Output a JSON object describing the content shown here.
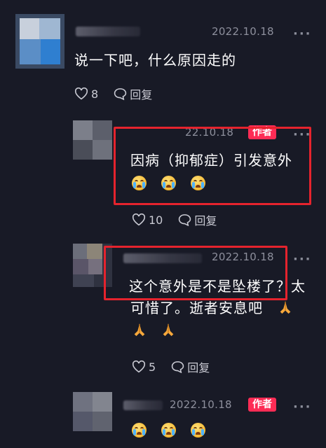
{
  "comments": [
    {
      "date": "2022.10.18",
      "text": "说一下吧，什么原因走的",
      "likes": "8",
      "reply_label": "回复"
    },
    {
      "date": "22.10.18",
      "badge": "作者",
      "text": "因病（抑郁症）引发意外",
      "emojis": [
        "crying-face",
        "crying-face",
        "crying-face"
      ],
      "likes": "10",
      "reply_label": "回复"
    },
    {
      "date": "2022.10.18",
      "text_line1": "这个意外是不是坠楼了？太",
      "text_line2": "可惜了。逝者安息吧",
      "emojis": [
        "folded-hands",
        "folded-hands",
        "folded-hands"
      ],
      "likes": "5",
      "reply_label": "回复"
    },
    {
      "date": "2022.10.18",
      "badge": "作者",
      "emojis": [
        "crying-face",
        "crying-face",
        "crying-face"
      ]
    }
  ],
  "icons": {
    "like": "heart-outline-icon",
    "reply": "chat-bubble-icon",
    "more": "more-dots-icon"
  },
  "colors": {
    "background": "#181a26",
    "highlight": "#e5232d",
    "badge": "#fe2c55",
    "muted": "#8d8f9c"
  }
}
